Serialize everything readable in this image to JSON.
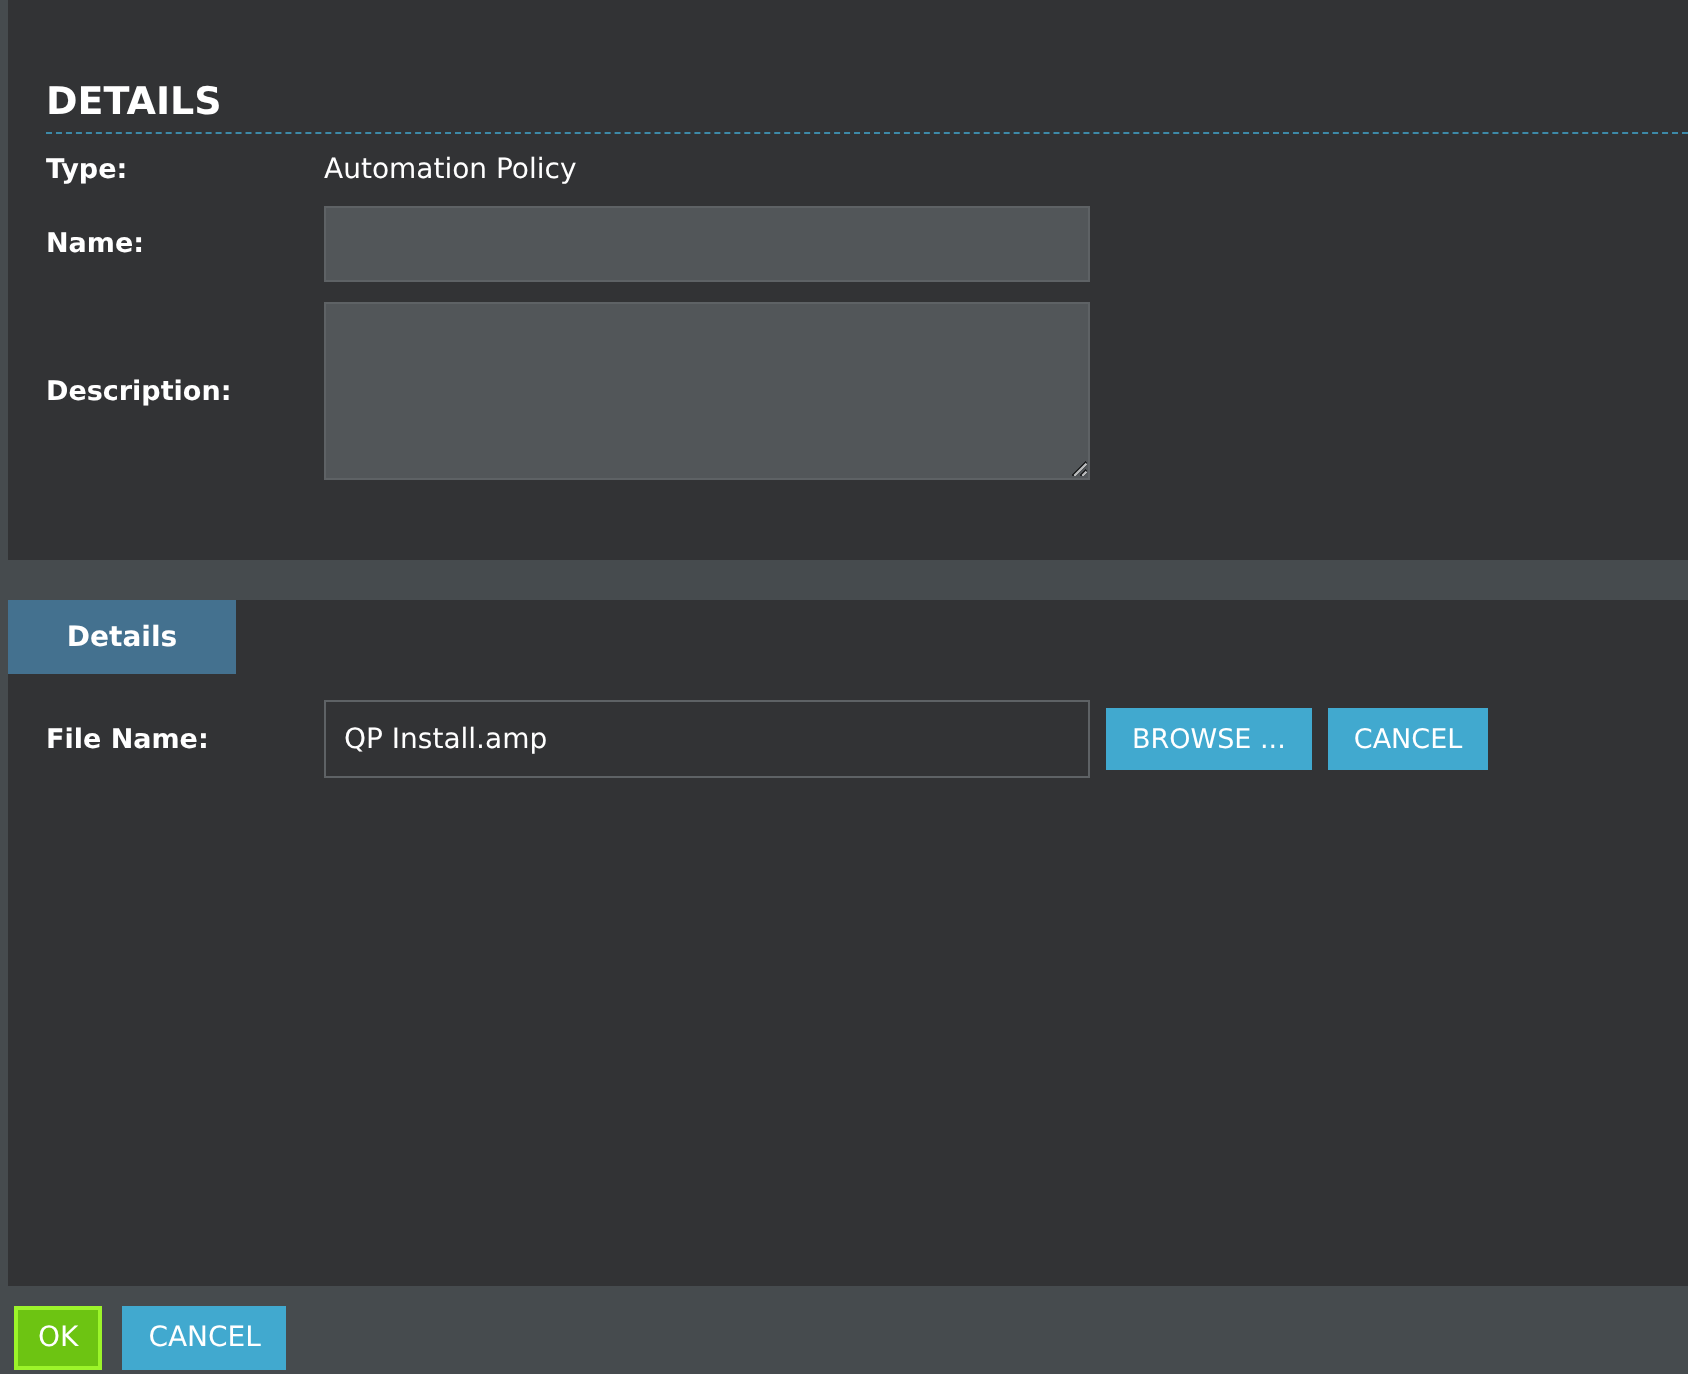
{
  "details": {
    "title": "DETAILS",
    "fields": [
      {
        "kind": "text",
        "label": "Type:",
        "value": "Automation Policy"
      },
      {
        "kind": "input",
        "label": "Name:"
      },
      {
        "kind": "textarea",
        "label": "Description:"
      }
    ]
  },
  "tabs": [
    {
      "label": "Details",
      "selected": true
    }
  ],
  "file": {
    "label": "File Name:",
    "value": "QP Install.amp",
    "buttons": [
      "BROWSE ...",
      "CANCEL"
    ]
  },
  "footer": {
    "ok": "OK",
    "cancel": "CANCEL"
  }
}
